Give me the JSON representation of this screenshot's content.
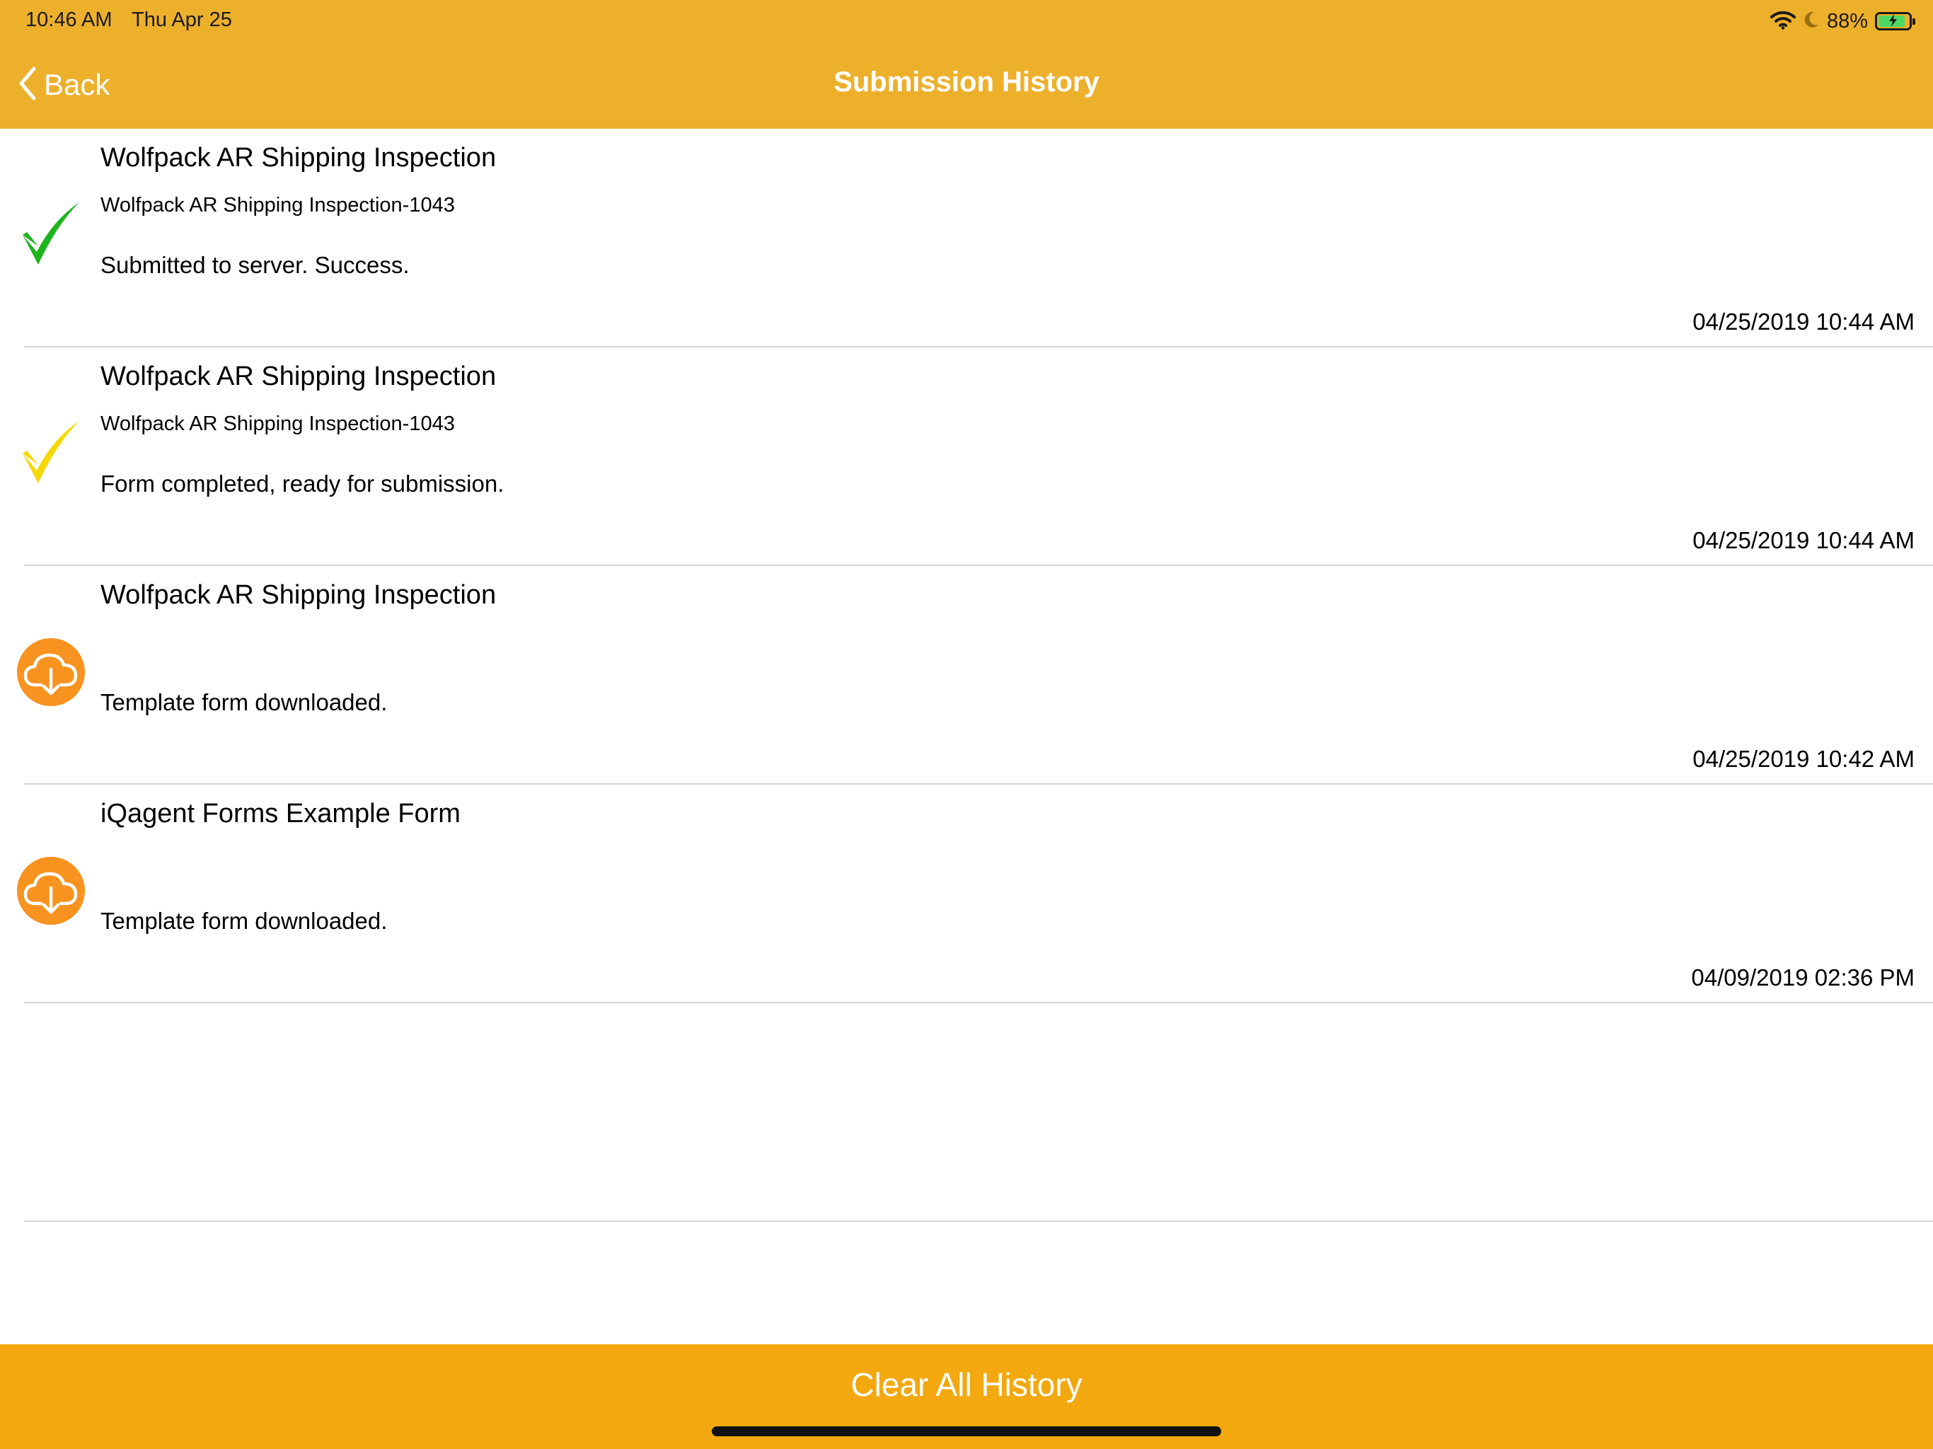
{
  "status_bar": {
    "time": "10:46 AM",
    "date": "Thu Apr 25",
    "battery_percent": "88%",
    "battery_level": 0.88,
    "icons": [
      "wifi-icon",
      "moon-icon",
      "battery-charging-icon"
    ]
  },
  "nav": {
    "back_label": "Back",
    "title": "Submission History"
  },
  "history": [
    {
      "title": "Wolfpack AR Shipping Inspection",
      "subtitle": "Wolfpack AR Shipping Inspection-1043",
      "status": "Submitted to server. Success.",
      "date": "04/25/2019 10:44 AM",
      "icon": "green-checkmark-icon"
    },
    {
      "title": "Wolfpack AR Shipping Inspection",
      "subtitle": "Wolfpack AR Shipping Inspection-1043",
      "status": "Form completed, ready for submission.",
      "date": "04/25/2019 10:44 AM",
      "icon": "yellow-checkmark-icon"
    },
    {
      "title": "Wolfpack AR Shipping Inspection",
      "subtitle": "",
      "status": "Template form downloaded.",
      "date": "04/25/2019 10:42 AM",
      "icon": "cloud-download-icon"
    },
    {
      "title": "iQagent Forms Example Form",
      "subtitle": "",
      "status": "Template form downloaded.",
      "date": "04/09/2019 02:36 PM",
      "icon": "cloud-download-icon"
    }
  ],
  "footer": {
    "clear_label": "Clear All History"
  },
  "colors": {
    "header": "#EDB02B",
    "footer": "#F2A80E",
    "success_check": "#1DB51D",
    "pending_check": "#F5D800",
    "download_circle": "#F7931E"
  }
}
